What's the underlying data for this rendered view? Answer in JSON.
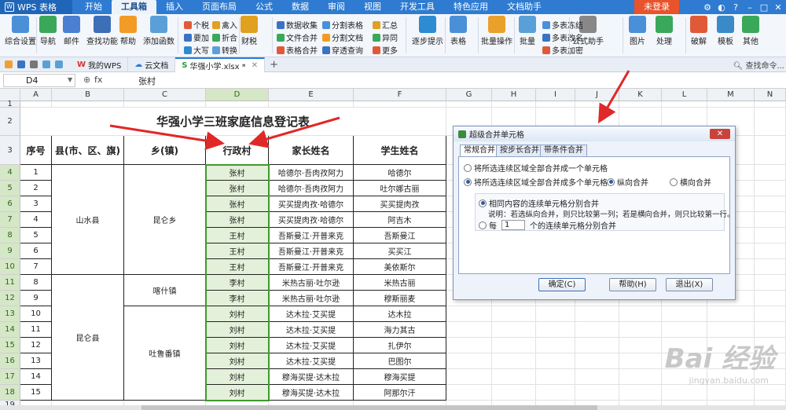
{
  "app": {
    "name": "WPS 表格"
  },
  "menu": {
    "tabs": [
      "开始",
      "工具箱",
      "插入",
      "页面布局",
      "公式",
      "数据",
      "审阅",
      "视图",
      "开发工具",
      "特色应用",
      "文档助手"
    ],
    "active_tab": "工具箱",
    "login_label": "未登录"
  },
  "ribbon": {
    "large": [
      "综合设置",
      "导航",
      "邮件",
      "查找功能",
      "帮助",
      "添加函数",
      "财税",
      "逐步提示",
      "表格",
      "批量操作",
      "批量",
      "公式助手",
      "图片",
      "处理",
      "破解",
      "模板",
      "其他"
    ],
    "small": [
      "个税",
      "要加",
      "大写",
      "禽入",
      "折合",
      "转换",
      "数据收集",
      "文件合并",
      "表格合并",
      "分割表格",
      "分割文档",
      "穿透查询",
      "汇总",
      "异同",
      "更多",
      "多表冻结",
      "多表改名",
      "多表加密"
    ]
  },
  "doc_tabs": [
    "我的WPS",
    "云文档",
    "华强小学.xlsx *"
  ],
  "search_label": "查找命令...",
  "formula_bar": {
    "cell_ref": "D4",
    "fx": "fx",
    "value": "张村"
  },
  "sheet": {
    "columns": [
      "A",
      "B",
      "C",
      "D",
      "E",
      "F",
      "G",
      "H",
      "I",
      "J",
      "K",
      "L",
      "M",
      "N"
    ],
    "rows": [
      "1",
      "2",
      "3",
      "4",
      "5",
      "6",
      "7",
      "8",
      "9",
      "10",
      "11",
      "12",
      "13",
      "14",
      "15",
      "16",
      "17",
      "18",
      "19"
    ],
    "title": "华强小学三班家庭信息登记表",
    "headers": [
      "序号",
      "县(市、区、旗)",
      "乡(镇)",
      "行政村",
      "家长姓名",
      "学生姓名"
    ],
    "records": [
      [
        "1",
        "张村",
        "哈德尔·吾肉孜阿力",
        "哈德尔"
      ],
      [
        "2",
        "张村",
        "哈德尔·吾肉孜阿力",
        "吐尔娜古丽"
      ],
      [
        "3",
        "张村",
        "买买提肉孜·哈德尔",
        "买买提肉孜"
      ],
      [
        "4",
        "张村",
        "买买提肉孜·哈德尔",
        "阿吉木"
      ],
      [
        "5",
        "王村",
        "吾斯曼江·开普来克",
        "吾斯曼江"
      ],
      [
        "6",
        "王村",
        "吾斯曼江·开普来克",
        "买买江"
      ],
      [
        "7",
        "王村",
        "吾斯曼江·开普来克",
        "美依斯尔"
      ],
      [
        "8",
        "李村",
        "米热古丽·吐尔逊",
        "米热古丽"
      ],
      [
        "9",
        "李村",
        "米热古丽·吐尔逊",
        "穆斯丽麦"
      ],
      [
        "10",
        "刘村",
        "达木拉·艾买提",
        "达木拉"
      ],
      [
        "11",
        "刘村",
        "达木拉·艾买提",
        "海力其古"
      ],
      [
        "12",
        "刘村",
        "达木拉·艾买提",
        "扎伊尔"
      ],
      [
        "13",
        "刘村",
        "达木拉·艾买提",
        "巴图尔"
      ],
      [
        "14",
        "刘村",
        "穆海买提·达木拉",
        "穆海买提"
      ],
      [
        "15",
        "刘村",
        "穆海买提·达木拉",
        "阿那尔汗"
      ]
    ],
    "county_1": "山水县",
    "county_2": "昆仑县",
    "town_1": "昆仑乡",
    "town_2": "喀什镇",
    "town_3": "吐鲁番镇"
  },
  "dialog": {
    "title": "超级合并单元格",
    "tabs": [
      "常规合并",
      "按步长合并",
      "带条件合并"
    ],
    "option1": "将所选连续区域全部合并成一个单元格",
    "option2": "将所选连续区域全部合并成多个单元格",
    "vertical": "纵向合并",
    "horizontal": "横向合并",
    "sub_option1": "相同内容的连续单元格分别合并",
    "note": "说明：若选纵向合并，则只比较第一列；若是横向合并，则只比较第一行。",
    "each_prefix": "每",
    "each_value": "1",
    "each_suffix": "个的连续单元格分别合并",
    "ok": "确定(C)",
    "help": "帮助(H)",
    "exit": "退出(X)"
  },
  "watermark": {
    "main": "Bai 经验",
    "sub": "jingyan.baidu.com"
  },
  "colors": {
    "brand": "#2e7bd1",
    "login": "#e8532b",
    "selection": "#3f9a2b",
    "arrow": "#e02828"
  }
}
